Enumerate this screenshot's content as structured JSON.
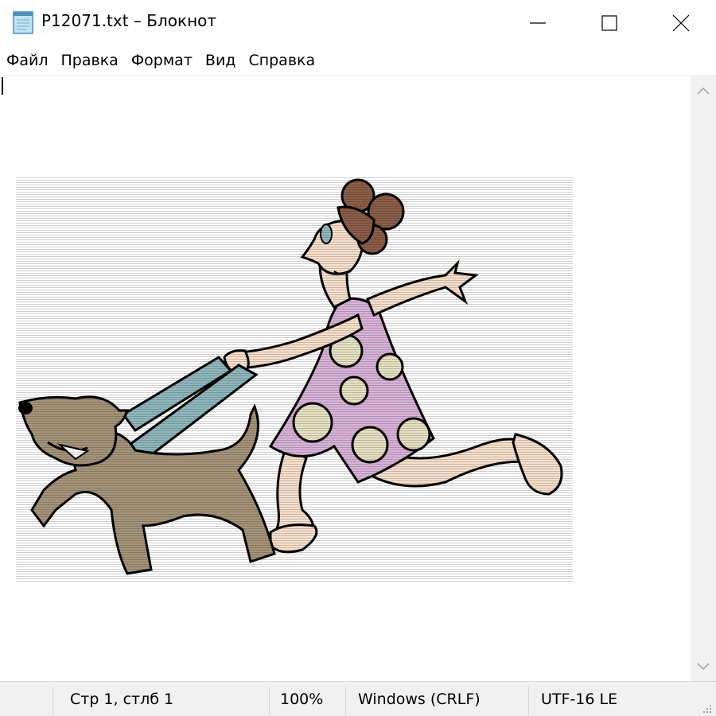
{
  "window": {
    "title": "P12071.txt – Блокнот",
    "icon": "notepad-icon",
    "controls": [
      "minimize-icon",
      "maximize-icon",
      "close-icon"
    ]
  },
  "menu": {
    "items": [
      "Файл",
      "Правка",
      "Формат",
      "Вид",
      "Справка"
    ]
  },
  "editor": {
    "content_description_icon": "ascii-art-woman-walking-dog"
  },
  "status": {
    "position": "Стр 1, стлб 1",
    "zoom": "100%",
    "line_endings": "Windows (CRLF)",
    "encoding": "UTF-16 LE"
  },
  "colors": {
    "dress": "#d9b3d9",
    "dots": "#e8e2c4",
    "skin": "#f7e0cc",
    "hair": "#8b5e48",
    "dog": "#a59479",
    "harness": "#8fb8bd",
    "statusbar": "#f0f0f0"
  }
}
